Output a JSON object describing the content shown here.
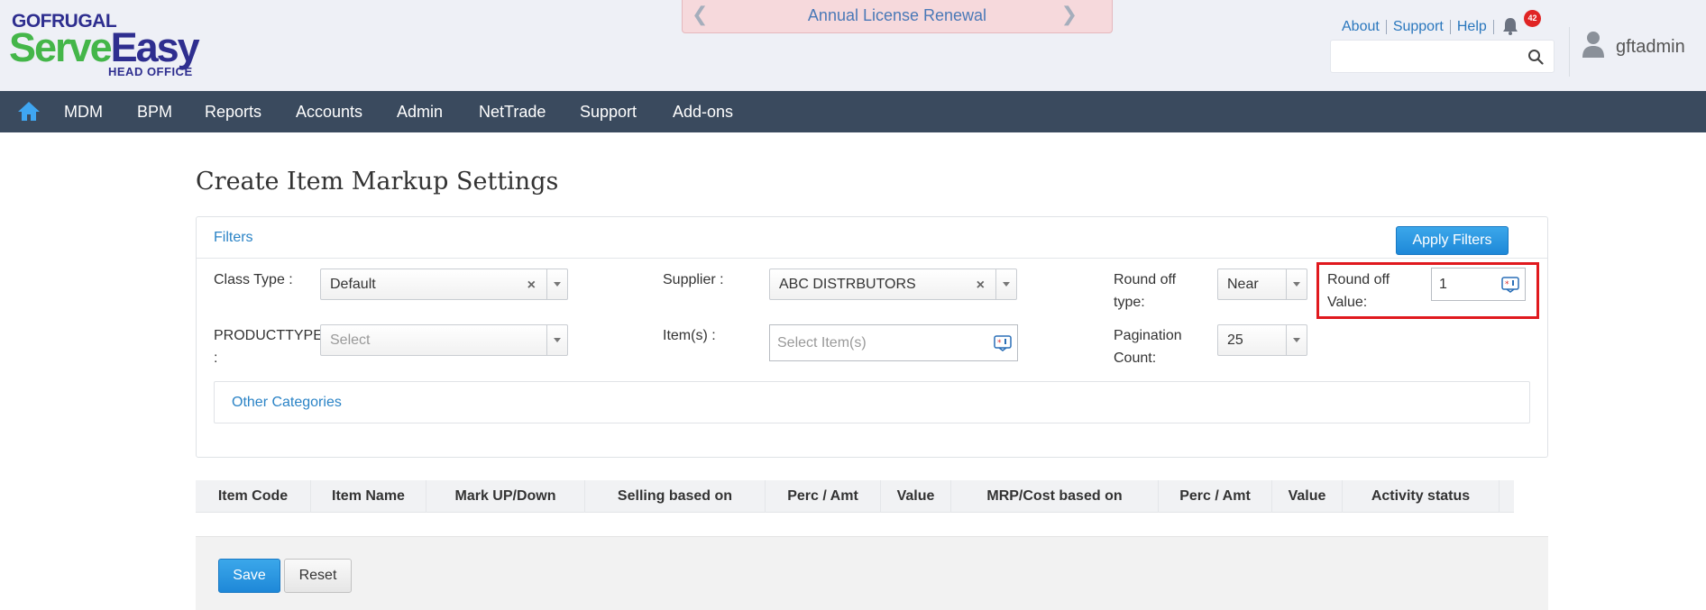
{
  "brand": {
    "company": "GOFRUGAL",
    "product_a": "Serve",
    "product_b": "Easy",
    "edition": "HEAD OFFICE"
  },
  "banner": {
    "text": "Annual License Renewal"
  },
  "toplinks": {
    "about": "About",
    "support": "Support",
    "help": "Help"
  },
  "notifications": {
    "count": "42"
  },
  "search": {
    "placeholder": ""
  },
  "user": {
    "name": "gftadmin"
  },
  "nav": {
    "items": [
      "MDM",
      "BPM",
      "Reports",
      "Accounts",
      "Admin",
      "NetTrade",
      "Support",
      "Add-ons"
    ]
  },
  "page": {
    "title": "Create Item Markup Settings"
  },
  "filters": {
    "header": "Filters",
    "apply_label": "Apply Filters",
    "class_type": {
      "label": "Class Type :",
      "value": "Default"
    },
    "supplier": {
      "label": "Supplier :",
      "value": "ABC DISTRBUTORS"
    },
    "round_off_type": {
      "label_1": "Round off",
      "label_2": "type:",
      "value": "Near"
    },
    "round_off_value": {
      "label_1": "Round off",
      "label_2": "Value:",
      "value": "1"
    },
    "product_type": {
      "label_1": "PRODUCTTYPE",
      "label_2": ":",
      "placeholder": "Select"
    },
    "items": {
      "label": "Item(s) :",
      "placeholder": "Select Item(s)"
    },
    "pagination": {
      "label_1": "Pagination",
      "label_2": "Count:",
      "value": "25"
    },
    "other_categories": "Other Categories"
  },
  "table": {
    "columns": [
      "Item Code",
      "Item Name",
      "Mark UP/Down",
      "Selling based on",
      "Perc / Amt",
      "Value",
      "MRP/Cost based on",
      "Perc / Amt",
      "Value",
      "Activity status"
    ]
  },
  "footer": {
    "save_label": "Save",
    "reset_label": "Reset"
  },
  "colors": {
    "nav_bg": "#3a4a5e",
    "accent_blue": "#1e88d8",
    "highlight_red": "#e0191e",
    "brand_green": "#44b649",
    "brand_navy": "#2e2e8f"
  }
}
